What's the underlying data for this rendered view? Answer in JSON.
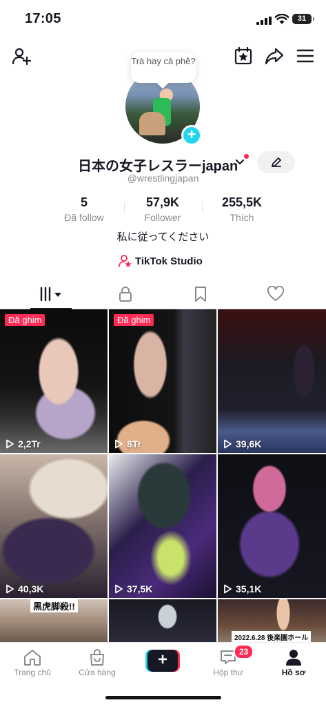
{
  "status_bar": {
    "time": "17:05",
    "battery": "31"
  },
  "bubble": {
    "text": "Trà hay cà phê?"
  },
  "profile": {
    "name": "日本の女子レスラーjapan",
    "handle": "@wrestlingjapan",
    "bio": "私に従ってください",
    "studio_label": "TikTok Studio"
  },
  "stats": [
    {
      "value": "5",
      "label": "Đã follow"
    },
    {
      "value": "57,9K",
      "label": "Follower"
    },
    {
      "value": "255,5K",
      "label": "Thích"
    }
  ],
  "tabs": [
    "videos-grid-icon",
    "lock-icon",
    "bookmark-icon",
    "heart-icon"
  ],
  "videos": [
    {
      "pinned": "Đã ghim",
      "views": "2,2Tr"
    },
    {
      "pinned": "Đã ghim",
      "views": "8Tr"
    },
    {
      "pinned": "",
      "views": "39,6K"
    },
    {
      "pinned": "",
      "views": "40,3K"
    },
    {
      "pinned": "",
      "views": "37,5K"
    },
    {
      "pinned": "",
      "views": "35,1K"
    },
    {
      "banner": "黒虎脚殺!!"
    },
    {},
    {
      "banner": "2022.6.28 後楽園ホール"
    }
  ],
  "bottom_nav": {
    "home": "Trang chủ",
    "shop": "Cửa hàng",
    "inbox": "Hộp thư",
    "inbox_badge": "23",
    "profile": "Hồ sơ"
  },
  "colors": {
    "accent": "#fe2c55",
    "cyan": "#20d5ec",
    "text": "#161823"
  }
}
